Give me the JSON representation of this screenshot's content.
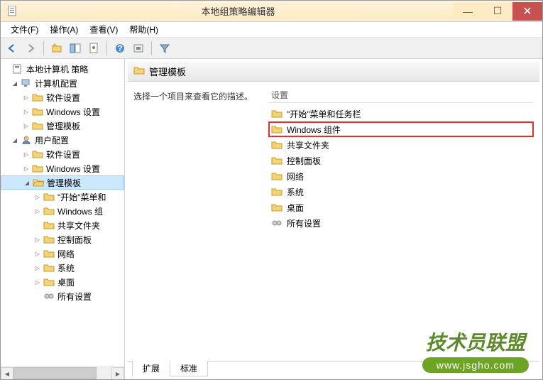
{
  "window": {
    "title": "本地组策略编辑器"
  },
  "menu": {
    "file": "文件(F)",
    "action": "操作(A)",
    "view": "查看(V)",
    "help": "帮助(H)"
  },
  "tree": {
    "root": "本地计算机 策略",
    "computer_config": "计算机配置",
    "user_config": "用户配置",
    "software_settings": "软件设置",
    "windows_settings": "Windows 设置",
    "admin_templates": "管理模板",
    "start_taskbar": "\"开始\"菜单和",
    "windows_comp": "Windows 组",
    "shared_folders": "共享文件夹",
    "control_panel": "控制面板",
    "network": "网络",
    "system": "系统",
    "desktop": "桌面",
    "all_settings": "所有设置"
  },
  "detail": {
    "header": "管理模板",
    "desc": "选择一个项目来查看它的描述。",
    "list_header": "设置",
    "items": {
      "start_taskbar": "\"开始\"菜单和任务栏",
      "windows_comp": "Windows 组件",
      "shared_folders": "共享文件夹",
      "control_panel": "控制面板",
      "network": "网络",
      "system": "系统",
      "desktop": "桌面",
      "all_settings": "所有设置"
    }
  },
  "tabs": {
    "extended": "扩展",
    "standard": "标准"
  },
  "watermark": {
    "title": "技术员联盟",
    "url": "www.jsgho.com"
  }
}
